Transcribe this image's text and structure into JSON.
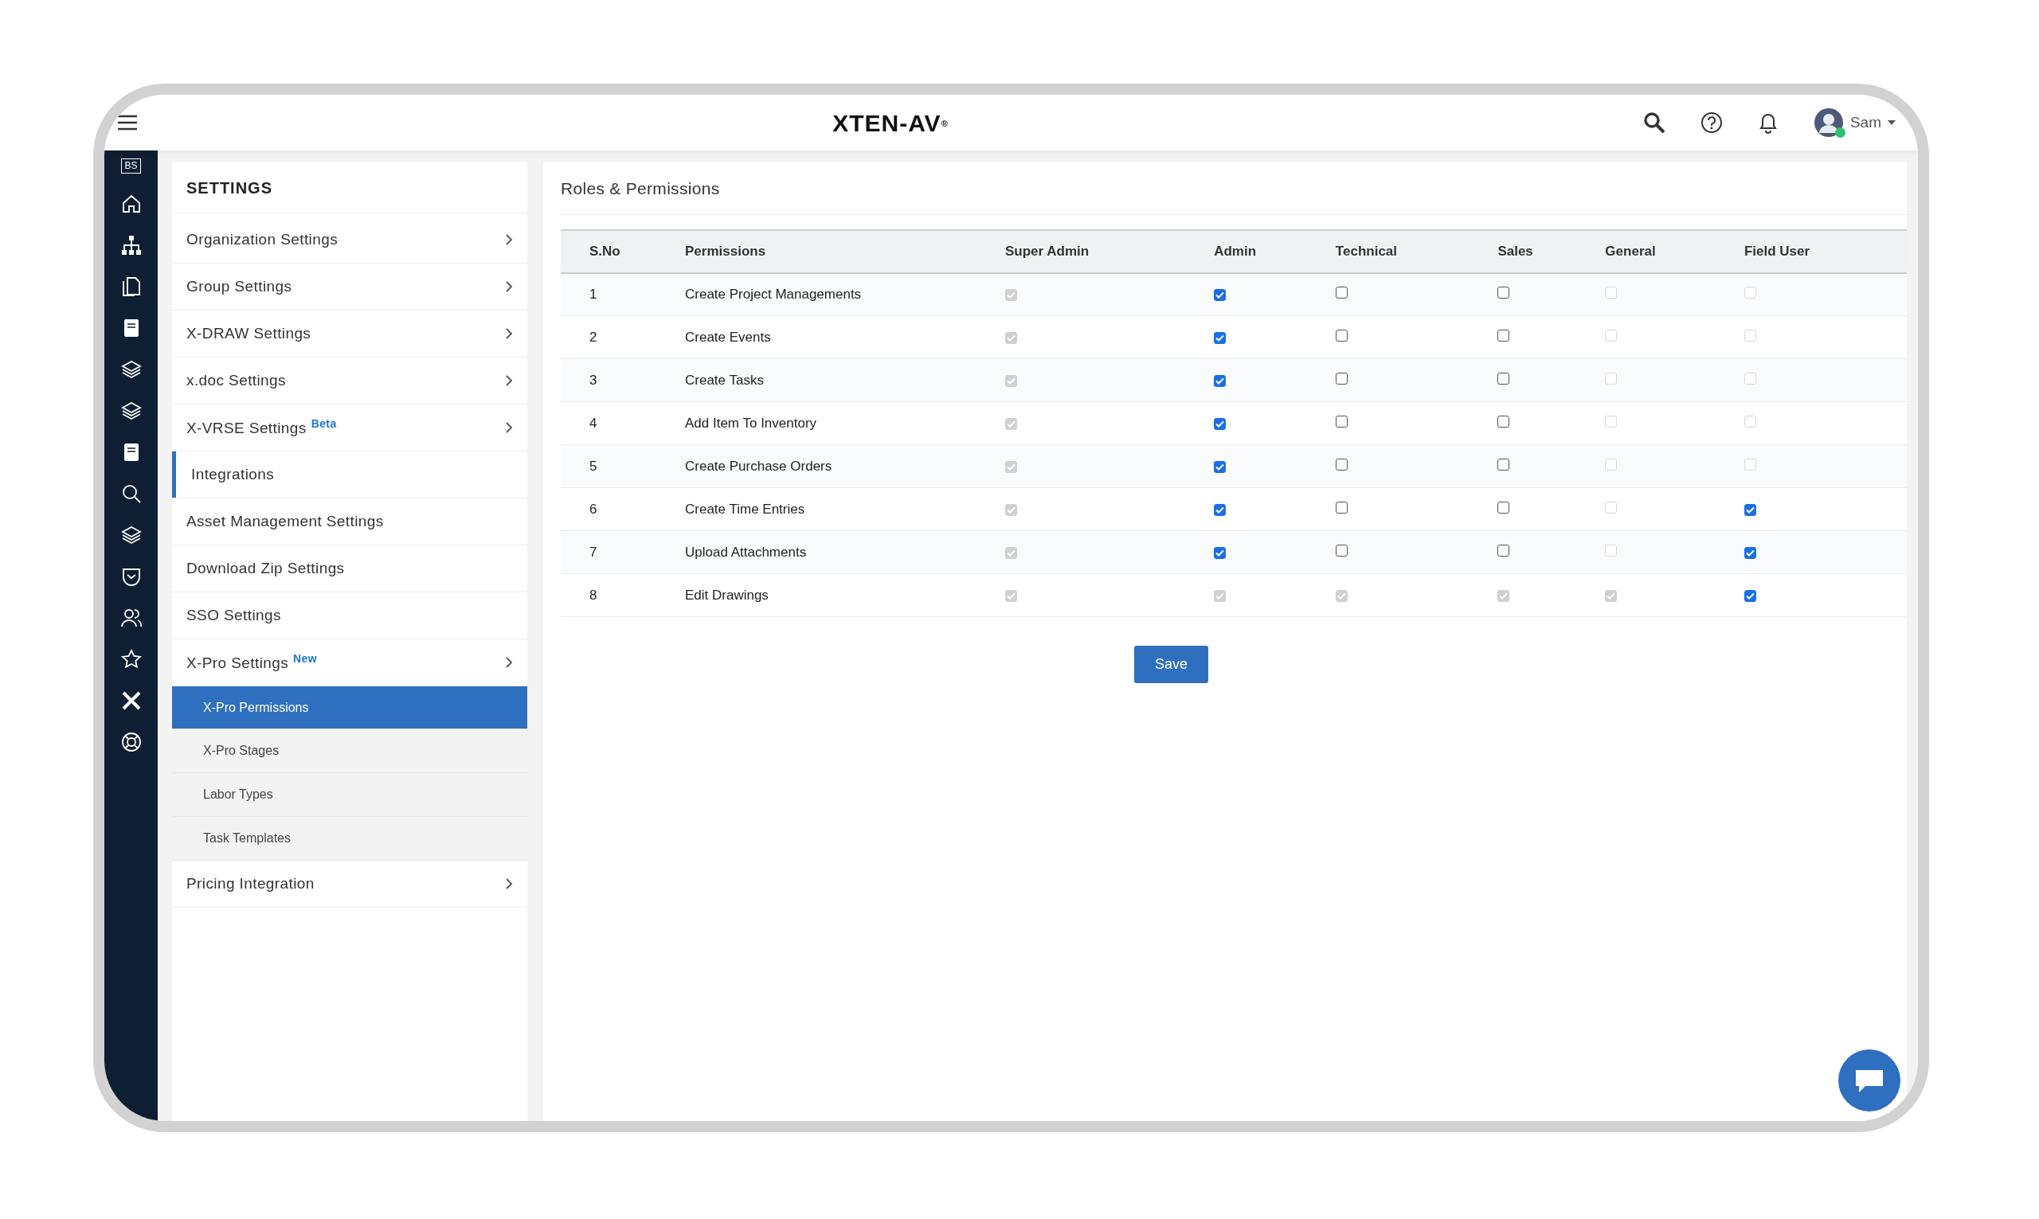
{
  "header": {
    "logo": "XTEN-AV",
    "logo_mark": "®",
    "user": {
      "name": "Sam",
      "online": true
    }
  },
  "rail": {
    "monogram": "BS"
  },
  "settings": {
    "title": "SETTINGS",
    "items": [
      {
        "label": "Organization Settings",
        "chevron": true,
        "active": false
      },
      {
        "label": "Group Settings",
        "chevron": true,
        "active": false
      },
      {
        "label": "X-DRAW Settings",
        "chevron": true,
        "active": false
      },
      {
        "label": "x.doc Settings",
        "chevron": true,
        "active": false
      },
      {
        "label": "X-VRSE Settings",
        "badge": "Beta",
        "chevron": true,
        "active": false
      },
      {
        "label": "Integrations",
        "chevron": false,
        "active": true
      },
      {
        "label": "Asset Management Settings",
        "chevron": false,
        "active": false
      },
      {
        "label": "Download Zip Settings",
        "chevron": false,
        "active": false
      },
      {
        "label": "SSO Settings",
        "chevron": false,
        "active": false
      },
      {
        "label": "X-Pro Settings",
        "badge": "New",
        "chevron": true,
        "active": false,
        "children": [
          {
            "label": "X-Pro Permissions",
            "selected": true
          },
          {
            "label": "X-Pro Stages",
            "selected": false
          },
          {
            "label": "Labor Types",
            "selected": false
          },
          {
            "label": "Task Templates",
            "selected": false
          }
        ]
      },
      {
        "label": "Pricing Integration",
        "chevron": true,
        "active": false
      }
    ]
  },
  "main": {
    "title": "Roles & Permissions",
    "table": {
      "columns": [
        "S.No",
        "Permissions",
        "Super Admin",
        "Admin",
        "Technical",
        "Sales",
        "General",
        "Field User"
      ],
      "rows": [
        {
          "sno": "1",
          "permission": "Create Project Managements",
          "cells": [
            {
              "checked": true,
              "disabled": true
            },
            {
              "checked": true,
              "disabled": false
            },
            {
              "checked": false,
              "disabled": false
            },
            {
              "checked": false,
              "disabled": false
            },
            {
              "checked": false,
              "disabled": true
            },
            {
              "checked": false,
              "disabled": true
            }
          ]
        },
        {
          "sno": "2",
          "permission": "Create Events",
          "cells": [
            {
              "checked": true,
              "disabled": true
            },
            {
              "checked": true,
              "disabled": false
            },
            {
              "checked": false,
              "disabled": false
            },
            {
              "checked": false,
              "disabled": false
            },
            {
              "checked": false,
              "disabled": true
            },
            {
              "checked": false,
              "disabled": true
            }
          ]
        },
        {
          "sno": "3",
          "permission": "Create Tasks",
          "cells": [
            {
              "checked": true,
              "disabled": true
            },
            {
              "checked": true,
              "disabled": false
            },
            {
              "checked": false,
              "disabled": false
            },
            {
              "checked": false,
              "disabled": false
            },
            {
              "checked": false,
              "disabled": true
            },
            {
              "checked": false,
              "disabled": true
            }
          ]
        },
        {
          "sno": "4",
          "permission": "Add Item To Inventory",
          "cells": [
            {
              "checked": true,
              "disabled": true
            },
            {
              "checked": true,
              "disabled": false
            },
            {
              "checked": false,
              "disabled": false
            },
            {
              "checked": false,
              "disabled": false
            },
            {
              "checked": false,
              "disabled": true
            },
            {
              "checked": false,
              "disabled": true
            }
          ]
        },
        {
          "sno": "5",
          "permission": "Create Purchase Orders",
          "cells": [
            {
              "checked": true,
              "disabled": true
            },
            {
              "checked": true,
              "disabled": false
            },
            {
              "checked": false,
              "disabled": false
            },
            {
              "checked": false,
              "disabled": false
            },
            {
              "checked": false,
              "disabled": true
            },
            {
              "checked": false,
              "disabled": true
            }
          ]
        },
        {
          "sno": "6",
          "permission": "Create Time Entries",
          "cells": [
            {
              "checked": true,
              "disabled": true
            },
            {
              "checked": true,
              "disabled": false
            },
            {
              "checked": false,
              "disabled": false
            },
            {
              "checked": false,
              "disabled": false
            },
            {
              "checked": false,
              "disabled": true
            },
            {
              "checked": true,
              "disabled": false
            }
          ]
        },
        {
          "sno": "7",
          "permission": "Upload Attachments",
          "cells": [
            {
              "checked": true,
              "disabled": true
            },
            {
              "checked": true,
              "disabled": false
            },
            {
              "checked": false,
              "disabled": false
            },
            {
              "checked": false,
              "disabled": false
            },
            {
              "checked": false,
              "disabled": true
            },
            {
              "checked": true,
              "disabled": false
            }
          ]
        },
        {
          "sno": "8",
          "permission": "Edit Drawings",
          "cells": [
            {
              "checked": true,
              "disabled": true
            },
            {
              "checked": true,
              "disabled": true
            },
            {
              "checked": true,
              "disabled": true
            },
            {
              "checked": true,
              "disabled": true
            },
            {
              "checked": true,
              "disabled": true
            },
            {
              "checked": true,
              "disabled": false
            }
          ]
        }
      ]
    },
    "save_button": "Save"
  }
}
